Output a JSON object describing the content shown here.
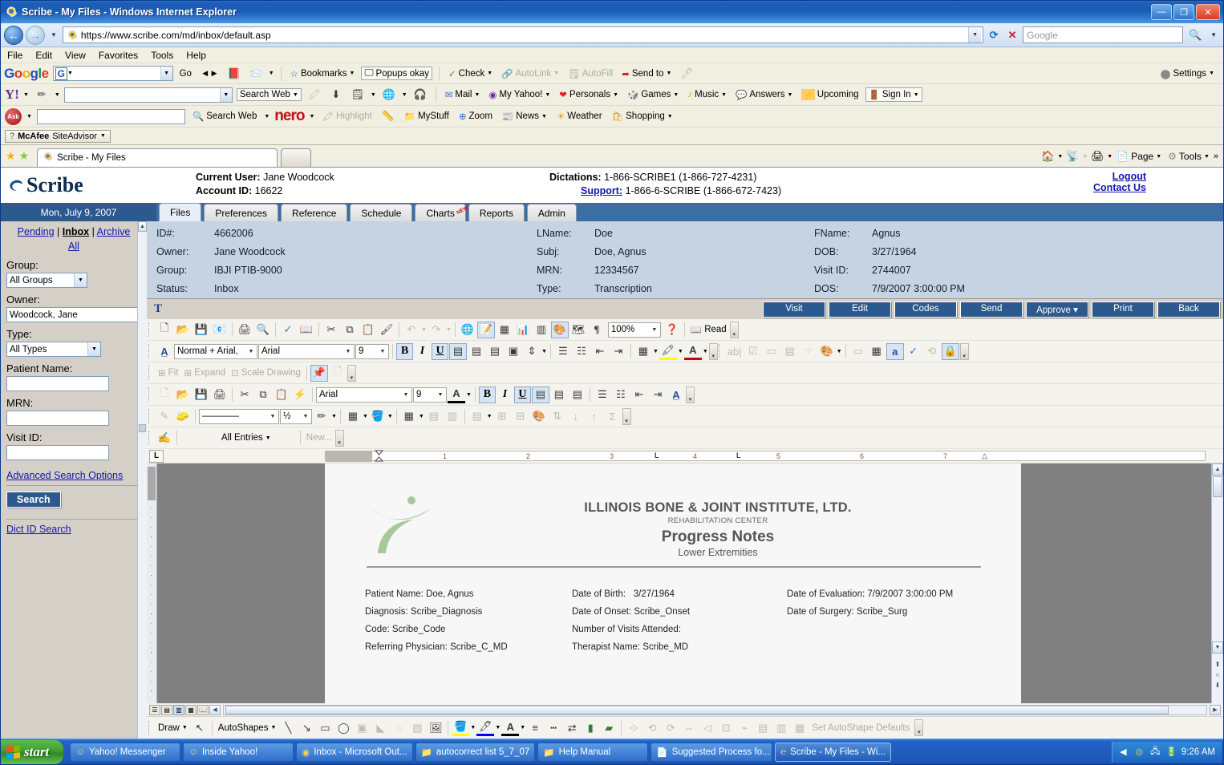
{
  "window": {
    "title": "Scribe - My Files - Windows Internet Explorer",
    "minimize": "—",
    "maximize": "❐",
    "close": "✕"
  },
  "address_bar": {
    "url": "https://www.scribe.com/md/inbox/default.asp",
    "back_icon": "back-arrow-icon",
    "forward_icon": "forward-arrow-icon",
    "refresh_icon": "↻",
    "stop_icon": "✕",
    "search_placeholder": "Google",
    "search_value": ""
  },
  "menu": {
    "items": [
      "File",
      "Edit",
      "View",
      "Favorites",
      "Tools",
      "Help"
    ]
  },
  "google_toolbar": {
    "logo": "Google",
    "search_value": "",
    "go_label": "Go",
    "bookmarks_label": "Bookmarks",
    "popups_label": "Popups okay",
    "check_label": "Check",
    "autolink_label": "AutoLink",
    "autofill_label": "AutoFill",
    "sendto_label": "Send to",
    "settings_label": "Settings"
  },
  "yahoo_toolbar": {
    "logo": "Y!",
    "search_value": "",
    "search_web_label": "Search Web",
    "mail_label": "Mail",
    "my_yahoo_label": "My Yahoo!",
    "personals_label": "Personals",
    "games_label": "Games",
    "music_label": "Music",
    "answers_label": "Answers",
    "upcoming_label": "Upcoming",
    "signin_label": "Sign In"
  },
  "ask_toolbar": {
    "logo": "Ask",
    "search_value": "",
    "search_web_label": "Search Web",
    "nero_label": "nero",
    "highlight_label": "Highlight",
    "mystuff_label": "MyStuff",
    "zoom_label": "Zoom",
    "news_label": "News",
    "weather_label": "Weather",
    "shopping_label": "Shopping"
  },
  "mcafee_toolbar": {
    "label_bold": "McAfee",
    "label_rest": "SiteAdvisor"
  },
  "tab_bar": {
    "tab_title": "Scribe - My Files",
    "home_label": "Home",
    "feeds_label": "Feeds",
    "print_label": "Print",
    "page_label": "Page",
    "tools_label": "Tools",
    "overflow": "»"
  },
  "scribe_header": {
    "logo": "Scribe",
    "current_user_label": "Current User:",
    "current_user_value": "Jane Woodcock",
    "account_id_label": "Account ID:",
    "account_id_value": "16622",
    "dictations_label": "Dictations:",
    "dictations_value": "1-866-SCRIBE1 (1-866-727-4231)",
    "support_label": "Support:",
    "support_value": "1-866-6-SCRIBE (1-866-672-7423)",
    "logout_label": "Logout",
    "contact_label": "Contact Us"
  },
  "app_tabs": {
    "date": "Mon, July 9, 2007",
    "items": [
      {
        "label": "Files",
        "active": true,
        "badge": ""
      },
      {
        "label": "Preferences",
        "active": false,
        "badge": ""
      },
      {
        "label": "Reference",
        "active": false,
        "badge": ""
      },
      {
        "label": "Schedule",
        "active": false,
        "badge": ""
      },
      {
        "label": "Charts",
        "active": false,
        "badge": "NEW"
      },
      {
        "label": "Reports",
        "active": false,
        "badge": ""
      },
      {
        "label": "Admin",
        "active": false,
        "badge": ""
      }
    ]
  },
  "sidebar": {
    "nav": {
      "pending": "Pending",
      "inbox": "Inbox",
      "archive": "Archive",
      "all": "All",
      "sep": "|"
    },
    "group_label": "Group:",
    "group_value": "All Groups",
    "owner_label": "Owner:",
    "owner_value": "Woodcock, Jane",
    "type_label": "Type:",
    "type_value": "All Types",
    "patient_name_label": "Patient Name:",
    "patient_name_value": "",
    "mrn_label": "MRN:",
    "mrn_value": "",
    "visit_id_label": "Visit ID:",
    "visit_id_value": "",
    "advanced_label": "Advanced Search Options",
    "search_button": "Search",
    "dict_id_label": "Dict ID Search"
  },
  "info_panel": {
    "col1": [
      {
        "label": "ID#:",
        "value": "4662006"
      },
      {
        "label": "Owner:",
        "value": "Jane Woodcock"
      },
      {
        "label": "Group:",
        "value": "IBJI PTIB-9000"
      },
      {
        "label": "Status:",
        "value": "Inbox"
      }
    ],
    "col2": [
      {
        "label": "LName:",
        "value": "Doe"
      },
      {
        "label": "Subj:",
        "value": "Doe, Agnus"
      },
      {
        "label": "MRN:",
        "value": "12334567"
      },
      {
        "label": "Type:",
        "value": "Transcription"
      }
    ],
    "col3": [
      {
        "label": "FName:",
        "value": "Agnus"
      },
      {
        "label": "DOB:",
        "value": "3/27/1964"
      },
      {
        "label": "Visit ID:",
        "value": "2744007"
      },
      {
        "label": "DOS:",
        "value": "7/9/2007 3:00:00 PM"
      }
    ]
  },
  "action_bar": {
    "t_glyph": "T",
    "buttons": [
      {
        "label": "Visit"
      },
      {
        "label": "Edit"
      },
      {
        "label": "Codes"
      },
      {
        "label": "Send"
      },
      {
        "label": "Approve ▾"
      },
      {
        "label": "Print"
      },
      {
        "label": "Back"
      }
    ]
  },
  "word_toolbars": {
    "standard": {
      "zoom_value": "100%",
      "read_label": "Read",
      "icons": [
        "new-document-icon",
        "open-folder-icon",
        "save-icon",
        "email-icon",
        "print-icon",
        "print-preview-icon",
        "spelling-check-icon",
        "research-icon",
        "cut-scissors-icon",
        "copy-icon",
        "paste-icon",
        "format-painter-icon",
        "undo-icon",
        "redo-icon",
        "insert-hyperlink-icon",
        "tables-borders-icon",
        "insert-table-icon",
        "insert-excel-icon",
        "columns-icon",
        "drawing-icon",
        "document-map-icon",
        "show-formatting-icon",
        "help-icon",
        "reading-layout-icon"
      ]
    },
    "formatting": {
      "style_value": "Normal + Arial,",
      "font_value": "Arial",
      "size_value": "9",
      "bold": "B",
      "italic": "I",
      "underline": "U"
    },
    "picture": {
      "fit_label": "Fit",
      "expand_label": "Expand",
      "scale_label": "Scale Drawing"
    },
    "secondary": {
      "font_value": "Arial",
      "size_value": "9",
      "bold": "B",
      "italic": "I",
      "underline": "U"
    },
    "tables": {
      "line_style": "————",
      "line_weight": "½"
    },
    "entries": {
      "all_entries": "All Entries",
      "new_label": "New..."
    }
  },
  "ruler": {
    "tab_glyph": "L",
    "marks": [
      "1",
      "2",
      "3",
      "4",
      "5",
      "6",
      "7"
    ]
  },
  "document": {
    "org_name": "ILLINOIS BONE & JOINT INSTITUTE, LTD.",
    "org_sub": "REHABILITATION CENTER",
    "doc_title": "Progress Notes",
    "doc_subtitle": "Lower Extremities",
    "fields": [
      [
        {
          "label": "Patient Name:",
          "value": "Doe, Agnus"
        },
        {
          "label": "Date of Birth:",
          "value": "3/27/1964"
        },
        {
          "label": "Date of Evaluation:",
          "value": "7/9/2007 3:00:00 PM"
        }
      ],
      [
        {
          "label": "Diagnosis:",
          "value": "Scribe_Diagnosis"
        },
        {
          "label": "Date of Onset:",
          "value": "Scribe_Onset"
        },
        {
          "label": "Date of Surgery:",
          "value": "Scribe_Surg"
        }
      ],
      [
        {
          "label": "Code:",
          "value": "Scribe_Code"
        },
        {
          "label": "Number of Visits Attended:",
          "value": ""
        },
        {
          "label": "",
          "value": ""
        }
      ],
      [
        {
          "label": "Referring Physician:",
          "value": "Scribe_C_MD"
        },
        {
          "label": "Therapist Name:",
          "value": "Scribe_MD"
        },
        {
          "label": "",
          "value": ""
        }
      ]
    ]
  },
  "draw_bar": {
    "draw_label": "Draw",
    "autoshapes_label": "AutoShapes",
    "defaults_label": "Set AutoShape Defaults"
  },
  "taskbar": {
    "start_label": "start",
    "tasks": [
      {
        "label": "Yahoo! Messenger",
        "icon": "messenger-icon",
        "active": false
      },
      {
        "label": "Inside Yahoo!",
        "icon": "messenger-icon",
        "active": false
      },
      {
        "label": "Inbox - Microsoft Out...",
        "icon": "outlook-icon",
        "active": false
      },
      {
        "label": "autocorrect list 5_7_07",
        "icon": "folder-icon",
        "active": false
      },
      {
        "label": "Help Manual",
        "icon": "folder-icon",
        "active": false
      },
      {
        "label": "Suggested Process fo...",
        "icon": "word-icon",
        "active": false
      },
      {
        "label": "Scribe - My Files - Wi...",
        "icon": "ie-icon",
        "active": true
      }
    ],
    "clock": "9:26 AM",
    "tray_icons": [
      "show-hidden-icon",
      "antivirus-icon",
      "network-icon",
      "battery-icon"
    ]
  },
  "colors": {
    "title_blue": "#1a5bb4",
    "scribe_blue": "#2d5a8e",
    "tab_strip": "#3a6ea5",
    "link": "#1414b0",
    "sidebar_bg": "#d4d0c8",
    "info_bg": "#c5d3e2",
    "doc_bg": "#808080"
  }
}
